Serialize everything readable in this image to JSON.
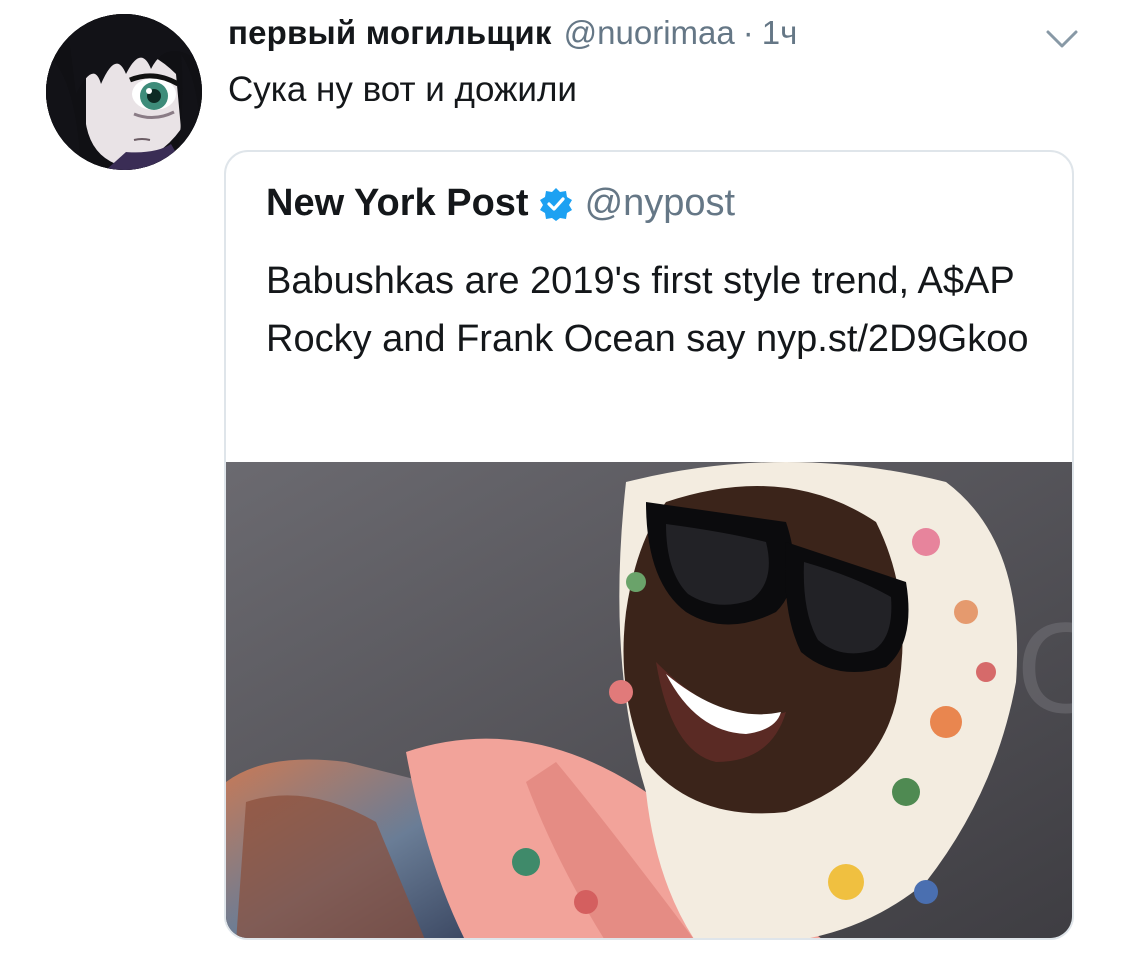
{
  "tweet": {
    "display_name": "первый могильщик",
    "handle": "@nuorimaa",
    "separator": "·",
    "time": "1ч",
    "text": "Сука ну вот и дожили",
    "avatar_icon": "anime-avatar",
    "menu_icon": "chevron-down-icon"
  },
  "quoted": {
    "display_name": "New York Post",
    "verified": true,
    "handle": "@nypost",
    "text": "Babushkas are 2019's first style trend, A$AP Rocky and Frank Ocean say nyp.st/2D9Gkoo",
    "media_icon": "photo-man-in-headscarf-sunglasses"
  },
  "colors": {
    "text_primary": "#14171a",
    "text_secondary": "#657786",
    "border": "#dfe5ea",
    "verified_blue": "#1da1f2"
  }
}
